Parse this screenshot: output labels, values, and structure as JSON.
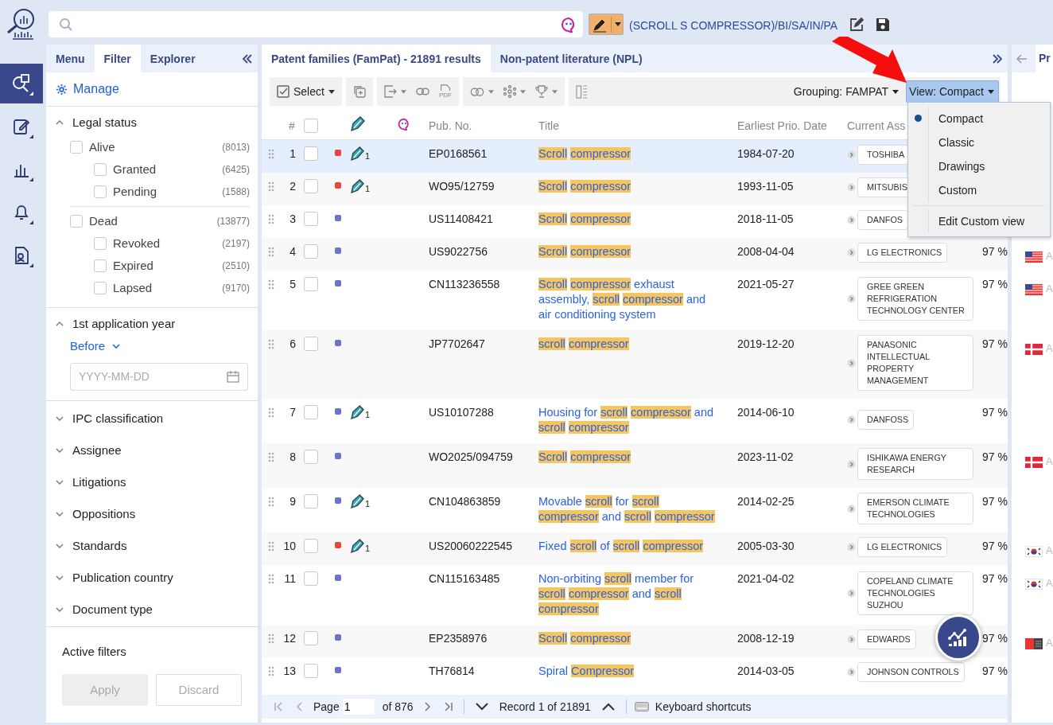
{
  "rail": [
    {
      "kind": "patent-search",
      "selected": true
    },
    {
      "kind": "edit",
      "selected": false
    },
    {
      "kind": "chart",
      "selected": false
    },
    {
      "kind": "bell",
      "selected": false
    },
    {
      "kind": "document",
      "selected": false
    }
  ],
  "query": {
    "text": "(SCROLL S COMPRESSOR)/BI/SA/IN/PA"
  },
  "left_tabs": [
    {
      "label": "Menu",
      "selected": false
    },
    {
      "label": "Filter",
      "selected": true
    },
    {
      "label": "Explorer",
      "selected": false
    }
  ],
  "manage": "Manage",
  "filters": [
    {
      "kind": "tree",
      "title": "Legal status",
      "expanded": true,
      "items": [
        {
          "label": "Alive",
          "count": "(8013)",
          "checked": false,
          "children": [
            {
              "label": "Granted",
              "count": "(6425)",
              "checked": false
            },
            {
              "label": "Pending",
              "count": "(1588)",
              "checked": false
            }
          ]
        },
        {
          "label": "Dead",
          "count": "(13877)",
          "checked": false,
          "children": [
            {
              "label": "Revoked",
              "count": "(2197)",
              "checked": false
            },
            {
              "label": "Expired",
              "count": "(2510)",
              "checked": false
            },
            {
              "label": "Lapsed",
              "count": "(9170)",
              "checked": false
            }
          ]
        }
      ]
    },
    {
      "kind": "date",
      "title": "1st application year",
      "expanded": true,
      "mode": "Before",
      "placeholder": "YYYY-MM-DD"
    },
    {
      "kind": "plain",
      "title": "IPC classification",
      "expanded": false
    },
    {
      "kind": "plain",
      "title": "Assignee",
      "expanded": false
    },
    {
      "kind": "plain",
      "title": "Litigations",
      "expanded": false
    },
    {
      "kind": "plain",
      "title": "Oppositions",
      "expanded": false
    },
    {
      "kind": "plain",
      "title": "Standards",
      "expanded": false
    },
    {
      "kind": "plain",
      "title": "Publication country",
      "expanded": false
    },
    {
      "kind": "plain",
      "title": "Document type",
      "expanded": false
    }
  ],
  "active_filters": "Active filters",
  "filter_buttons": [
    {
      "label": "Apply",
      "kind": "filled",
      "disabled": true
    },
    {
      "label": "Discard",
      "kind": "outline",
      "disabled": true
    }
  ],
  "result_tabs": [
    {
      "label": "Patent families (FamPat) - 21891 results",
      "selected": true
    },
    {
      "label": "Non-patent literature (NPL)",
      "selected": false
    }
  ],
  "toolbar": {
    "select": "Select",
    "pdf": "PDF",
    "grouping": "Grouping: FAMPAT",
    "view": "View: Compact"
  },
  "view_menu": {
    "open": true,
    "items": [
      {
        "label": "Compact",
        "selected": true
      },
      {
        "label": "Classic",
        "selected": false
      },
      {
        "label": "Drawings",
        "selected": false
      },
      {
        "label": "Custom",
        "selected": false
      }
    ],
    "footer_item": "Edit Custom view"
  },
  "table": {
    "all_checked": false,
    "columns": {
      "number": "#",
      "pub_no": "Pub. No.",
      "title": "Title",
      "date": "Earliest Prio. Date",
      "assignee": "Current Ass"
    }
  },
  "rows": [
    {
      "number": "1",
      "selected": true,
      "checked": false,
      "color": "#e8453c",
      "annotations": "1",
      "pub_no": "EP0168561",
      "title": [
        {
          "text": "Scroll",
          "highlight": true
        },
        {
          "text": "compressor",
          "highlight": true
        }
      ],
      "date": "1984-07-20",
      "assignee": "TOSHIBA"
    },
    {
      "number": "2",
      "selected": false,
      "checked": false,
      "color": "#e8453c",
      "annotations": "1",
      "pub_no": "WO95/12759",
      "title": [
        {
          "text": "Scroll",
          "highlight": true
        },
        {
          "text": "compressor",
          "highlight": true
        }
      ],
      "date": "1993-11-05",
      "assignee": "MITSUBIS"
    },
    {
      "number": "3",
      "selected": false,
      "checked": false,
      "color": "#6b74c9",
      "pub_no": "US11408421",
      "title": [
        {
          "text": "Scroll",
          "highlight": true
        },
        {
          "text": "compressor",
          "highlight": true
        }
      ],
      "date": "2018-11-05",
      "assignee": "DANFOS"
    },
    {
      "number": "4",
      "selected": false,
      "checked": false,
      "color": "#6b74c9",
      "pub_no": "US9022756",
      "title": [
        {
          "text": "Scroll",
          "highlight": true
        },
        {
          "text": "compressor",
          "highlight": true
        }
      ],
      "date": "2008-04-04",
      "assignee": "LG ELECTRONICS",
      "score": "97 %",
      "flag": {
        "kind": "us",
        "label": "A"
      }
    },
    {
      "number": "5",
      "selected": false,
      "checked": false,
      "color": "#6b74c9",
      "pub_no": "CN113236558",
      "title": [
        {
          "text": "Scroll",
          "highlight": true
        },
        {
          "text": "compressor",
          "highlight": true
        },
        {
          "text": "exhaust assembly,",
          "highlight": false
        },
        {
          "text": "scroll",
          "highlight": true
        },
        {
          "text": "compressor",
          "highlight": true
        },
        {
          "text": "and air conditioning system",
          "highlight": false
        }
      ],
      "date": "2021-05-27",
      "assignee": "GREE GREEN REFRIGERATION TECHNOLOGY CENTER",
      "score": "97 %",
      "flag": {
        "kind": "us",
        "label": "A"
      }
    },
    {
      "number": "6",
      "selected": false,
      "checked": false,
      "color": "#6b74c9",
      "pub_no": "JP7702647",
      "title": [
        {
          "text": "scroll",
          "highlight": true
        },
        {
          "text": "compressor",
          "highlight": true
        }
      ],
      "date": "2019-12-20",
      "assignee": "PANASONIC INTELLECTUAL PROPERTY MANAGEMENT",
      "score": "97 %",
      "flag": {
        "kind": "dk",
        "label": "A"
      }
    },
    {
      "number": "7",
      "selected": false,
      "checked": false,
      "color": "#6b74c9",
      "annotations": "1",
      "pub_no": "US10107288",
      "title": [
        {
          "text": "Housing for",
          "highlight": false
        },
        {
          "text": "scroll",
          "highlight": true
        },
        {
          "text": "compressor",
          "highlight": true
        },
        {
          "text": "and",
          "highlight": false
        },
        {
          "text": "scroll",
          "highlight": true
        },
        {
          "text": "compressor",
          "highlight": true
        }
      ],
      "date": "2014-06-10",
      "assignee": "DANFOSS",
      "score": "97 %"
    },
    {
      "number": "8",
      "selected": false,
      "checked": false,
      "color": "#6b74c9",
      "pub_no": "WO2025/094759",
      "title": [
        {
          "text": "Scroll",
          "highlight": true
        },
        {
          "text": "compressor",
          "highlight": true
        }
      ],
      "date": "2023-11-02",
      "assignee": "ISHIKAWA ENERGY RESEARCH",
      "score": "97 %",
      "flag": {
        "kind": "dk",
        "label": "A"
      }
    },
    {
      "number": "9",
      "selected": false,
      "checked": false,
      "color": "#6b74c9",
      "annotations": "1",
      "pub_no": "CN104863859",
      "title": [
        {
          "text": "Movable",
          "highlight": false
        },
        {
          "text": "scroll",
          "highlight": true
        },
        {
          "text": "for",
          "highlight": false
        },
        {
          "text": "scroll",
          "highlight": true
        },
        {
          "text": "compressor",
          "highlight": true
        },
        {
          "text": "and",
          "highlight": false
        },
        {
          "text": "scroll",
          "highlight": true
        },
        {
          "text": "compressor",
          "highlight": true
        }
      ],
      "date": "2014-02-25",
      "assignee": "EMERSON CLIMATE TECHNOLOGIES",
      "score": "97 %"
    },
    {
      "number": "10",
      "selected": false,
      "checked": false,
      "color": "#e8453c",
      "annotations": "1",
      "pub_no": "US20060222545",
      "title": [
        {
          "text": "Fixed",
          "highlight": false
        },
        {
          "text": "scroll",
          "highlight": true
        },
        {
          "text": "of",
          "highlight": false
        },
        {
          "text": "scroll",
          "highlight": true
        },
        {
          "text": "compressor",
          "highlight": true
        }
      ],
      "date": "2005-03-30",
      "assignee": "LG ELECTRONICS",
      "score": "97 %",
      "flag": {
        "kind": "kr",
        "label": "A"
      }
    },
    {
      "number": "11",
      "selected": false,
      "checked": false,
      "color": "#6b74c9",
      "pub_no": "CN115163485",
      "title": [
        {
          "text": "Non-orbiting",
          "highlight": false
        },
        {
          "text": "scroll",
          "highlight": true
        },
        {
          "text": "member for",
          "highlight": false
        },
        {
          "text": "scroll",
          "highlight": true
        },
        {
          "text": "compressor",
          "highlight": true
        },
        {
          "text": "and",
          "highlight": false
        },
        {
          "text": "scroll",
          "highlight": true
        },
        {
          "text": "compressor",
          "highlight": true
        }
      ],
      "date": "2021-04-02",
      "assignee": "COPELAND CLIMATE TECHNOLOGIES SUZHOU",
      "score": "97 %",
      "flag": {
        "kind": "kr",
        "label": "A"
      }
    },
    {
      "number": "12",
      "selected": false,
      "checked": false,
      "color": "#6b74c9",
      "pub_no": "EP2358976",
      "title": [
        {
          "text": "Scroll",
          "highlight": true
        },
        {
          "text": "compressor",
          "highlight": true
        }
      ],
      "date": "2008-12-19",
      "assignee": "EDWARDS",
      "score": "97 %",
      "flag": {
        "kind": "office",
        "label": "A"
      }
    },
    {
      "number": "13",
      "selected": false,
      "checked": false,
      "color": "#6b74c9",
      "pub_no": "TH76814",
      "title": [
        {
          "text": "Spiral",
          "highlight": false
        },
        {
          "text": "Compressor",
          "highlight": true
        }
      ],
      "date": "2014-03-05",
      "assignee": "JOHNSON CONTROLS",
      "score": "97 %"
    }
  ],
  "pager": {
    "page_label": "Page",
    "page": "1",
    "page_count": "of 876",
    "record": "Record 1 of 21891",
    "shortcuts": "Keyboard shortcuts"
  },
  "right_panel": {
    "tab": "Pr"
  }
}
